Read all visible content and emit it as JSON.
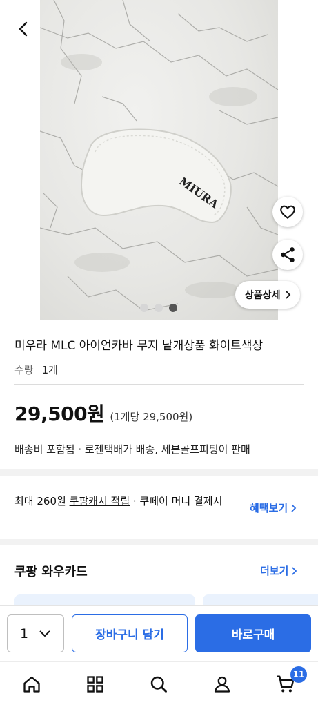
{
  "product": {
    "image_brand_text": "MIURA",
    "title": "미우라 MLC 아이언카바 무지 낱개상품 화이트색상",
    "qty_label": "수량",
    "qty_value": "1개",
    "price": "29,500원",
    "unit_price": "(1개당 29,500원)",
    "shipping": "배송비 포함됨 ·  로젠택배가 배송, 세븐골프피팅이 판매",
    "detail_button": "상품상세",
    "image_page": {
      "current": 3,
      "total": 3
    }
  },
  "benefit": {
    "prefix": "최대 260원 ",
    "cash": "쿠팡캐시 적립",
    "suffix": " · 쿠페이 머니 결제시",
    "link": "혜택보기"
  },
  "wow_card": {
    "title": "쿠팡 와우카드",
    "more": "더보기"
  },
  "buy_bar": {
    "quantity": "1",
    "cart_label": "장바구니 담기",
    "buy_label": "바로구매"
  },
  "tab_bar": {
    "items": [
      "home-icon",
      "categories-icon",
      "search-icon",
      "account-icon",
      "cart-icon"
    ],
    "cart_count": "11"
  },
  "colors": {
    "accent": "#2b6de5",
    "divider": "#f2f2f2"
  }
}
